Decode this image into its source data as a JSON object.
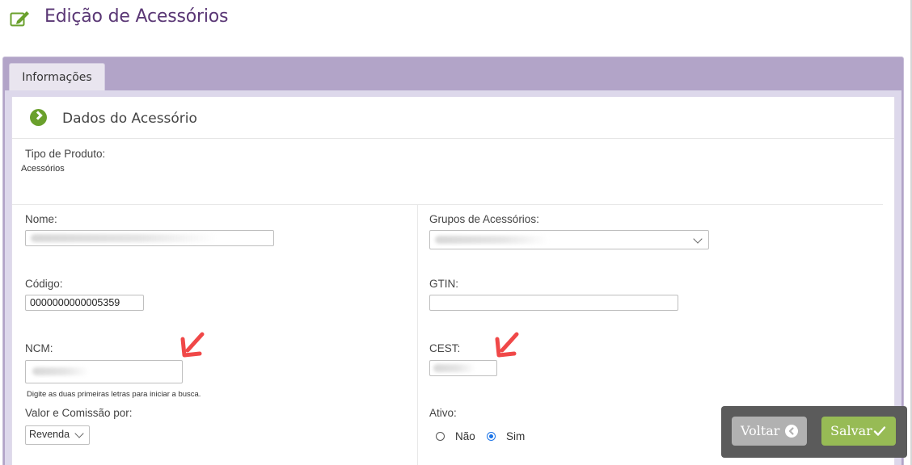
{
  "header": {
    "title": "Edição de Acessórios",
    "icon": "edit-icon"
  },
  "tabs": [
    {
      "label": "Informações",
      "active": true
    }
  ],
  "section": {
    "title": "Dados do Acessório",
    "icon": "chevron-circle-right-icon"
  },
  "form": {
    "tipo_produto": {
      "label": "Tipo de Produto:",
      "value": "Acessórios"
    },
    "nome": {
      "label": "Nome:",
      "value": ""
    },
    "grupos": {
      "label": "Grupos de Acessórios:",
      "value": ""
    },
    "codigo": {
      "label": "Código:",
      "value": "0000000000005359"
    },
    "gtin": {
      "label": "GTIN:",
      "value": ""
    },
    "ncm": {
      "label": "NCM:",
      "value": "",
      "hint": "Digite as duas primeiras letras para iniciar a busca."
    },
    "cest": {
      "label": "CEST:",
      "value": ""
    },
    "valor_comissao": {
      "label": "Valor e Comissão por:",
      "selected": "Revenda"
    },
    "ativo": {
      "label": "Ativo:",
      "options": [
        {
          "label": "Não",
          "checked": false
        },
        {
          "label": "Sim",
          "checked": true
        }
      ]
    }
  },
  "actions": {
    "back_label": "Voltar",
    "save_label": "Salvar"
  },
  "colors": {
    "title": "#5a3775",
    "panel": "#b2a4c8",
    "accent_green": "#97bb55",
    "annotation_arrow": "#f04848"
  }
}
